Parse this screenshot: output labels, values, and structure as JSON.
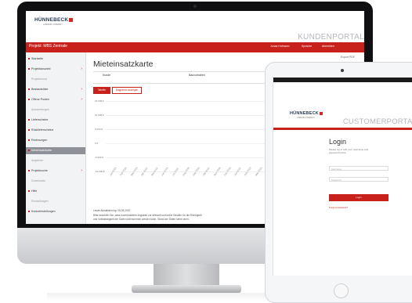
{
  "brand": {
    "logo": "HÜNNEBECK",
    "logo_sub": "a BRAND COMPANY",
    "accent_color": "#c8211b"
  },
  "desktop_portal": {
    "portal_title": "KUNDENPORTAL",
    "top_bar_title": "Projekt: MBS Zentrale",
    "menu": [
      "Jonas Hofmann",
      "Sprache",
      "Abmelden"
    ],
    "sidebar": [
      {
        "label": "Startseite",
        "type": "item"
      },
      {
        "label": "Projektauswahl",
        "type": "item",
        "has_arrow": true
      },
      {
        "label": "Projektmenü",
        "type": "group"
      },
      {
        "label": "Bestandsliste",
        "type": "item",
        "has_arrow": true
      },
      {
        "label": "Offene Posten",
        "type": "item",
        "has_arrow": true
      },
      {
        "label": "Auswertungen",
        "type": "group"
      },
      {
        "label": "Lieferscheine",
        "type": "item"
      },
      {
        "label": "Rücklieferscheine",
        "type": "item"
      },
      {
        "label": "Rechnungen",
        "type": "item"
      },
      {
        "label": "Mieteinsatzkarte",
        "type": "active"
      },
      {
        "label": "Angebote",
        "type": "group"
      },
      {
        "label": "Projektsuche",
        "type": "item",
        "has_arrow": true
      },
      {
        "label": "Downloads",
        "type": "group"
      },
      {
        "label": "Hilfe",
        "type": "item"
      },
      {
        "label": "Einstellungen",
        "type": "group"
      },
      {
        "label": "Kontoeinstellungen",
        "type": "item"
      }
    ],
    "page_title": "Mieteinsatzkarte",
    "top_right_link": "Export PDF",
    "table_headers": [
      "Kunde",
      "Bauvorhaben"
    ],
    "buttons": [
      "Tabelle",
      "Diagramm anzeigen"
    ],
    "chart_y_labels": [
      "15.000 €",
      "10.000 €",
      "5.000 €",
      "0 €",
      "-5.000 €",
      "-10.000 €"
    ],
    "chart_x_labels": [
      "Jan 2018",
      "Feb 2018",
      "Mär 2018",
      "Apr 2018",
      "Mai 2018",
      "Jun 2018",
      "Jul 2018",
      "Aug 2018",
      "Sep 2018",
      "Okt 2018",
      "Nov 2018",
      "Dez 2018",
      "Jan 2019",
      "Feb 2019",
      "Mär 2019",
      "Apr 2019",
      "Mai 2019"
    ],
    "footer_lines": [
      "Letzte Aktualisierung: 05.05.2019",
      "Bitte beachten Sie, dass unverbindliche Angaben zur Mietzeit und keine Gewähr für die Richtigkeit",
      "und Vollständigkeit der Daten übernommen werden kann. Stand der Daten siehe oben."
    ]
  },
  "tablet_portal": {
    "portal_title": "CUSTOMERPORTAL",
    "login_heading": "Login",
    "login_intro": [
      "Please log in with your username and",
      "password below."
    ],
    "username_placeholder": "Username",
    "password_placeholder": "Password",
    "login_button": "Login",
    "forgot_link": "Forgot password?"
  }
}
